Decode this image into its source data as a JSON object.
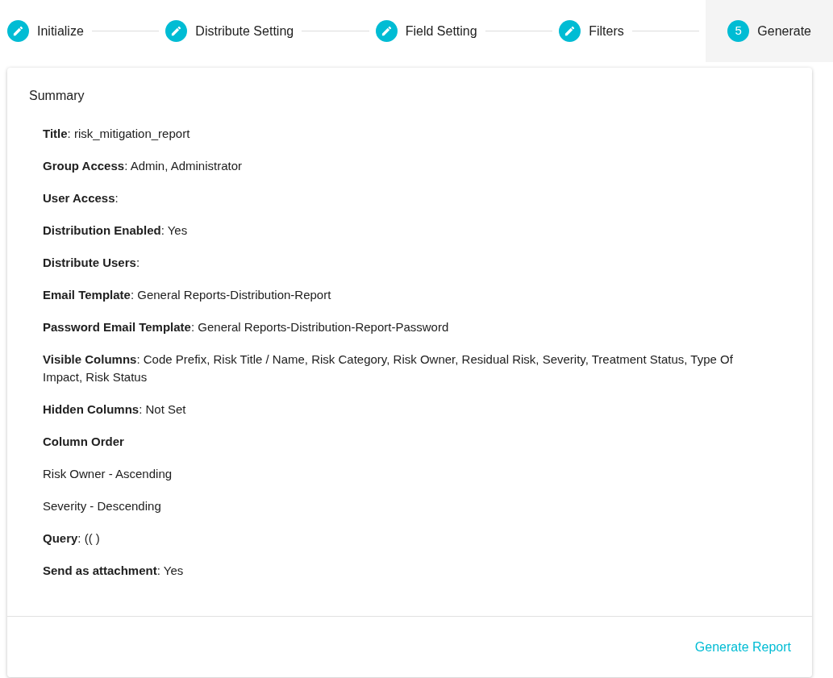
{
  "steps": [
    {
      "label": "Initialize",
      "selected": false
    },
    {
      "label": "Distribute Setting",
      "selected": false
    },
    {
      "label": "Field Setting",
      "selected": false
    },
    {
      "label": "Filters",
      "selected": false
    },
    {
      "label": "Generate",
      "selected": true,
      "number": "5"
    }
  ],
  "summary": {
    "title": "Summary",
    "items": [
      {
        "kind": "text",
        "text": "**Title**: risk_mitigation_report"
      },
      {
        "kind": "text",
        "text": "**Group Access**: Admin, Administrator"
      },
      {
        "kind": "text",
        "text": "**User Access**:"
      },
      {
        "kind": "text",
        "text": "**Distribution Enabled**: Yes"
      },
      {
        "kind": "text",
        "text": "**Distribute Users**:"
      },
      {
        "kind": "text",
        "text": "**Email Template**: General Reports-Distribution-Report"
      },
      {
        "kind": "text",
        "text": "**Password Email Template**: General Reports-Distribution-Report-Password"
      },
      {
        "kind": "text",
        "text": "**Visible Columns**: Code Prefix, Risk Title / Name, Risk Category, Risk Owner, Residual Risk, Severity, Treatment Status, Type Of Impact, Risk Status"
      },
      {
        "kind": "text",
        "text": "**Hidden Columns**: Not Set"
      },
      {
        "kind": "text",
        "text": "**Column Order**"
      },
      {
        "kind": "text",
        "text": "Risk Owner - Ascending"
      },
      {
        "kind": "text",
        "text": "Severity - Descending"
      },
      {
        "kind": "text",
        "text": "**Query**: (( )"
      },
      {
        "kind": "text",
        "text": "**Send as attachment**: Yes"
      }
    ]
  },
  "action": "Generate Report"
}
